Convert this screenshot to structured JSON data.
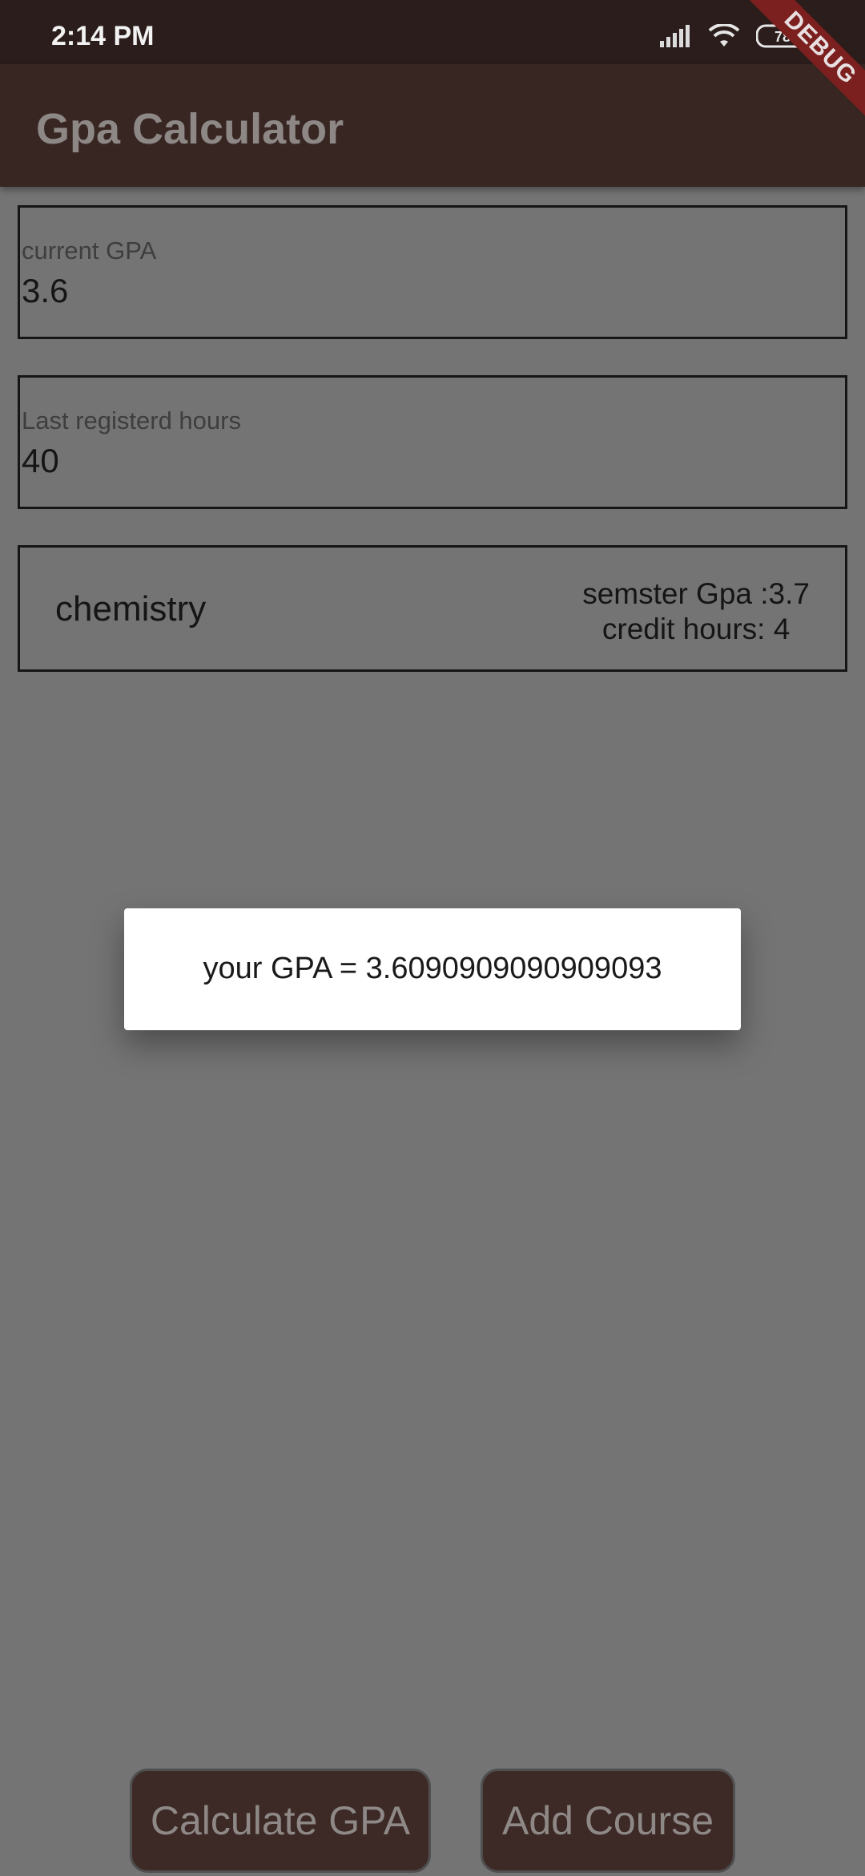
{
  "status_bar": {
    "time": "2:14 PM",
    "battery": "78"
  },
  "app_bar": {
    "title": "Gpa Calculator"
  },
  "debug_banner": "DEBUG",
  "fields": {
    "current_gpa": {
      "label": "current GPA",
      "value": "3.6"
    },
    "last_hours": {
      "label": "Last registerd hours",
      "value": "40"
    }
  },
  "course": {
    "name": "chemistry",
    "gpa_text": "semster Gpa :3.7",
    "hours_text": "credit hours: 4"
  },
  "dialog": {
    "message": "your GPA = 3.6090909090909093"
  },
  "buttons": {
    "calculate": "Calculate GPA",
    "add_course": "Add Course"
  },
  "colors": {
    "app_bar": "#382622",
    "status_bar": "#2b1d1b",
    "scrim_background": "#747474",
    "button": "#3d2a26",
    "debug_ribbon": "#7c1f1f"
  }
}
